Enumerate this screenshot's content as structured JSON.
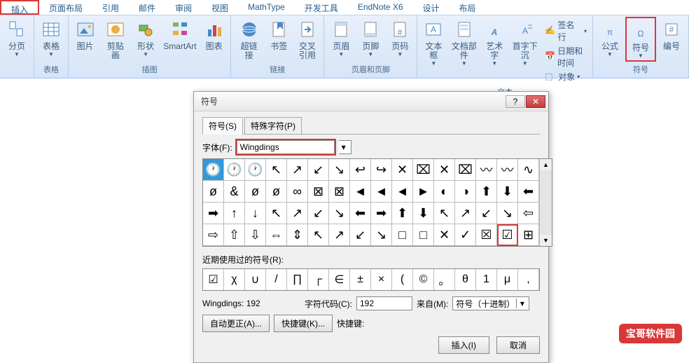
{
  "tabs": [
    "插入",
    "页面布局",
    "引用",
    "邮件",
    "审阅",
    "视图",
    "MathType",
    "开发工具",
    "EndNote X6",
    "设计",
    "布局"
  ],
  "ribbon_groups": {
    "pages": {
      "label": "",
      "items": [
        {
          "name": "section",
          "label": "分页"
        }
      ]
    },
    "tables": {
      "label": "表格",
      "items": [
        {
          "name": "table",
          "label": "表格"
        }
      ]
    },
    "illustrations": {
      "label": "插图",
      "items": [
        {
          "name": "picture",
          "label": "图片"
        },
        {
          "name": "clipart",
          "label": "剪贴画"
        },
        {
          "name": "shapes",
          "label": "形状"
        },
        {
          "name": "smartart",
          "label": "SmartArt"
        },
        {
          "name": "chart",
          "label": "图表"
        }
      ]
    },
    "links": {
      "label": "链接",
      "items": [
        {
          "name": "hyperlink",
          "label": "超链接"
        },
        {
          "name": "bookmark",
          "label": "书签"
        },
        {
          "name": "crossref",
          "label": "交叉\n引用"
        }
      ]
    },
    "headerfooter": {
      "label": "页眉和页脚",
      "items": [
        {
          "name": "header",
          "label": "页眉"
        },
        {
          "name": "footer",
          "label": "页脚"
        },
        {
          "name": "pageno",
          "label": "页码"
        }
      ]
    },
    "text": {
      "label": "文本",
      "items": [
        {
          "name": "textbox",
          "label": "文本框"
        },
        {
          "name": "quickparts",
          "label": "文档部件"
        },
        {
          "name": "wordart",
          "label": "艺术字"
        },
        {
          "name": "dropcap",
          "label": "首字下沉"
        }
      ],
      "extra": [
        {
          "name": "sigline",
          "label": "签名行"
        },
        {
          "name": "datetime",
          "label": "日期和时间"
        },
        {
          "name": "object",
          "label": "对象"
        }
      ]
    },
    "symbols": {
      "label": "符号",
      "items": [
        {
          "name": "equation",
          "label": "公式"
        },
        {
          "name": "symbol",
          "label": "符号"
        },
        {
          "name": "number",
          "label": "编号"
        }
      ]
    }
  },
  "dialog": {
    "title": "符号",
    "tabs": [
      "符号(S)",
      "特殊字符(P)"
    ],
    "font_label": "字体(F):",
    "font_value": "Wingdings",
    "grid": [
      [
        "🕐",
        "🕐",
        "🕐",
        "↖",
        "↗",
        "↙",
        "↘",
        "↩",
        "↪",
        "✕",
        "⌧",
        "✕",
        "⌧",
        "〰",
        "〰",
        "∿"
      ],
      [
        "ø",
        "&",
        "ø",
        "ø",
        "∞",
        "⊠",
        "⊠",
        "◄",
        "◄",
        "◄",
        "►",
        "◐",
        "◑",
        "⬆",
        "⬇",
        "⬅"
      ],
      [
        "➡",
        "↑",
        "↓",
        "↖",
        "↗",
        "↙",
        "↘",
        "⬅",
        "➡",
        "⬆",
        "⬇",
        "↖",
        "↗",
        "↙",
        "↘",
        "⇦"
      ],
      [
        "⇨",
        "⇧",
        "⇩",
        "⇔",
        "⇕",
        "↖",
        "↗",
        "↙",
        "↘",
        "□",
        "□",
        "✕",
        "✓",
        "☒",
        "☑",
        "⊞"
      ]
    ],
    "recent_label": "近期使用过的符号(R):",
    "recent": [
      "☑",
      "χ",
      "∪",
      "/",
      "∏",
      "┌",
      "∈",
      "±",
      "×",
      "(",
      "©",
      "。",
      "θ",
      "1",
      "μ",
      ","
    ],
    "char_name": "Wingdings: 192",
    "char_code_label": "字符代码(C):",
    "char_code": "192",
    "from_label": "来自(M):",
    "from_value": "符号（十进制）",
    "autocorrect": "自动更正(A)...",
    "shortcut": "快捷键(K)...",
    "shortcut_label": "快捷键:",
    "insert": "插入(I)",
    "cancel": "取消"
  },
  "watermark": "宝哥软件园"
}
